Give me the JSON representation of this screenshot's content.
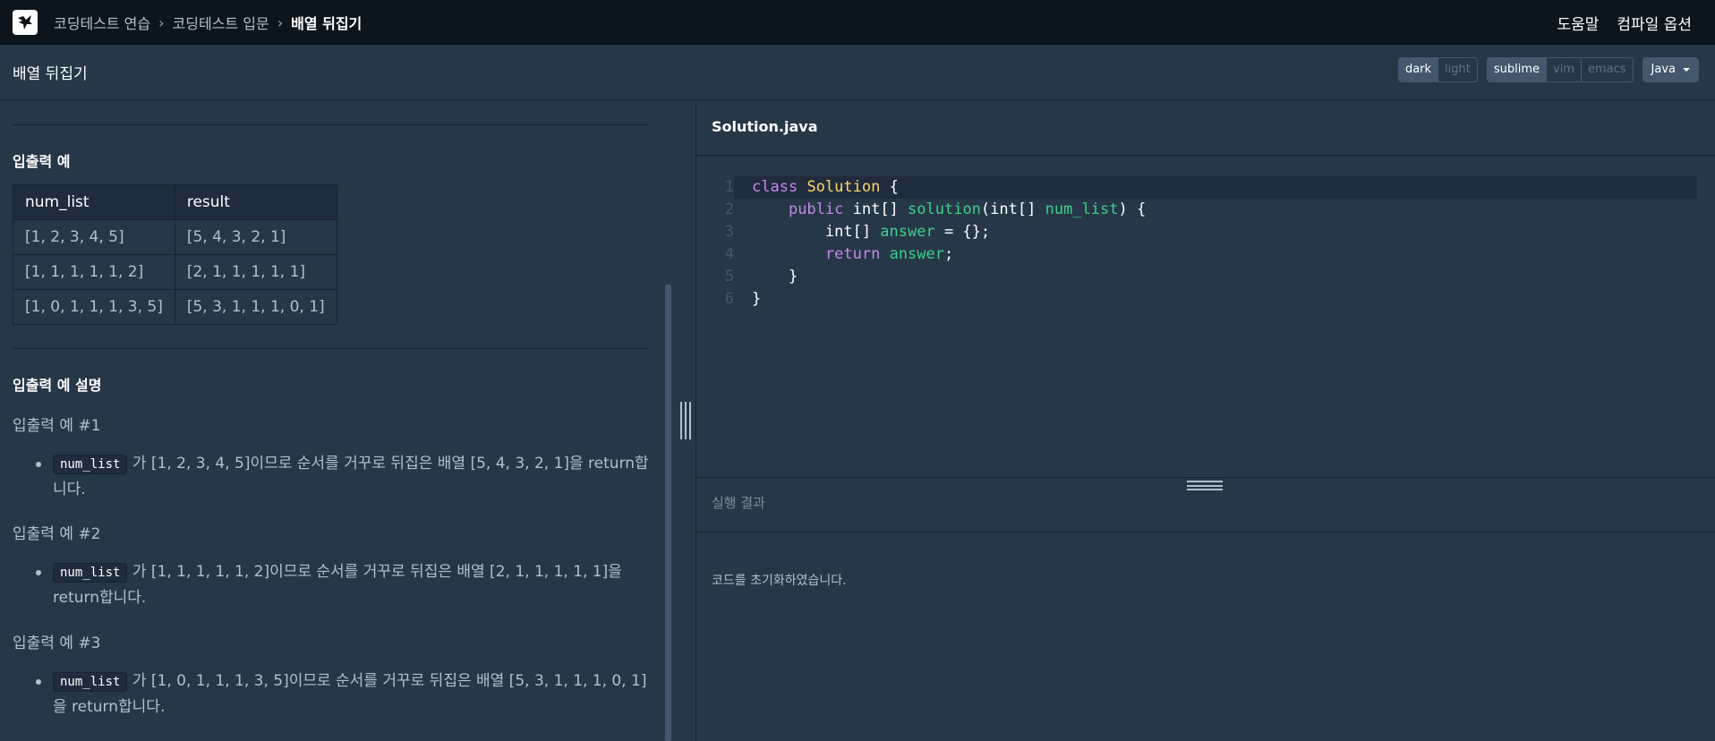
{
  "nav": {
    "breadcrumbs": [
      "코딩테스트 연습",
      "코딩테스트 입문",
      "배열 뒤집기"
    ],
    "help": "도움말",
    "compile_options": "컴파일 옵션"
  },
  "header": {
    "title": "배열 뒤집기",
    "theme_options": [
      "dark",
      "light"
    ],
    "theme_selected": "dark",
    "keymap_options": [
      "sublime",
      "vim",
      "emacs"
    ],
    "keymap_selected": "sublime",
    "language": "Java"
  },
  "problem": {
    "io_title": "입출력 예",
    "table": {
      "headers": [
        "num_list",
        "result"
      ],
      "rows": [
        [
          "[1, 2, 3, 4, 5]",
          "[5, 4, 3, 2, 1]"
        ],
        [
          "[1, 1, 1, 1, 1, 2]",
          "[2, 1, 1, 1, 1, 1]"
        ],
        [
          "[1, 0, 1, 1, 1, 3, 5]",
          "[5, 3, 1, 1, 1, 0, 1]"
        ]
      ]
    },
    "explain_title": "입출력 예 설명",
    "examples": [
      {
        "title": "입출력 예 #1",
        "code": "num_list",
        "text": " 가 [1, 2, 3, 4, 5]이므로 순서를 거꾸로 뒤집은 배열 [5, 4, 3, 2, 1]을 return합니다."
      },
      {
        "title": "입출력 예 #2",
        "code": "num_list",
        "text": " 가 [1, 1, 1, 1, 1, 2]이므로 순서를 거꾸로 뒤집은 배열 [2, 1, 1, 1, 1, 1]을 return합니다."
      },
      {
        "title": "입출력 예 #3",
        "code": "num_list",
        "text": " 가 [1, 0, 1, 1, 1, 3, 5]이므로 순서를 거꾸로 뒤집은 배열 [5, 3, 1, 1, 1, 0, 1]을 return합니다."
      }
    ]
  },
  "editor": {
    "filename": "Solution.java",
    "line_numbers": [
      "1",
      "2",
      "3",
      "4",
      "5",
      "6"
    ],
    "lines": [
      "class Solution {",
      "    public int[] solution(int[] num_list) {",
      "        int[] answer = {};",
      "        return answer;",
      "    }",
      "}"
    ]
  },
  "result": {
    "title": "실행 결과",
    "message": "코드를 초기화하였습니다."
  }
}
